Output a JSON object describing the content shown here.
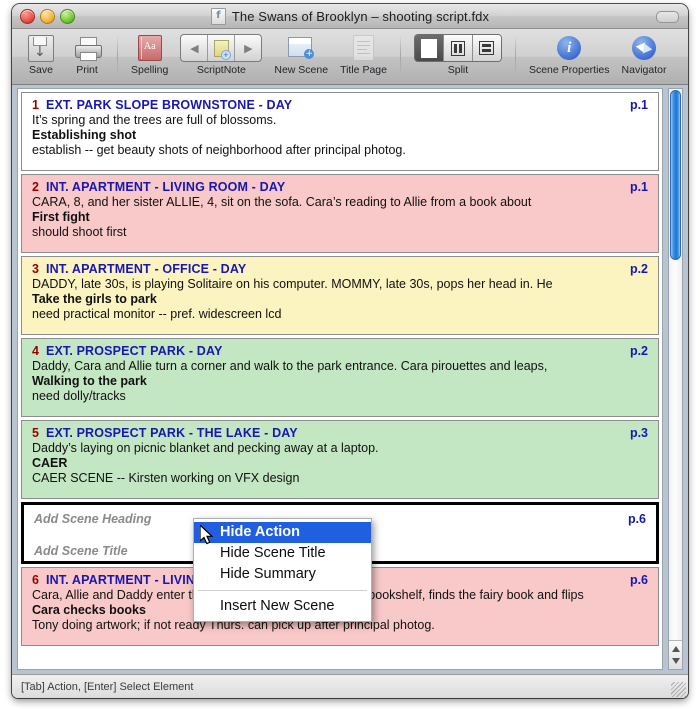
{
  "window": {
    "title": "The Swans of Brooklyn – shooting script.fdx",
    "doc_icon": "script-document-icon",
    "traffic_lights": [
      "close-button",
      "minimize-button",
      "zoom-button"
    ]
  },
  "toolbar": {
    "items": [
      {
        "label": "Save",
        "icon": "save-icon"
      },
      {
        "label": "Print",
        "icon": "print-icon"
      },
      {
        "label": "Spelling",
        "icon": "spelling-icon"
      },
      {
        "label": "ScriptNote",
        "icon": "scriptnote-icon"
      },
      {
        "label": "New Scene",
        "icon": "new-scene-icon"
      },
      {
        "label": "Title Page",
        "icon": "title-page-icon"
      },
      {
        "label": "Split",
        "icon": "split-icon"
      },
      {
        "label": "Scene Properties",
        "icon": "info-icon"
      },
      {
        "label": "Navigator",
        "icon": "compass-icon"
      }
    ],
    "spelling_glyph": "Aa",
    "split_selected": "single-pane"
  },
  "cards": [
    {
      "number": "1",
      "heading": "EXT. PARK SLOPE BROWNSTONE - DAY",
      "page": "p.1",
      "action": "It’s spring and the trees are full of blossoms.",
      "title": "Establishing shot",
      "summary": "establish -- get beauty shots of neighborhood after principal photog.",
      "color": "#ffffff"
    },
    {
      "number": "2",
      "heading": "INT. APARTMENT - LIVING ROOM - DAY",
      "page": "p.1",
      "action": "CARA, 8, and her sister ALLIE, 4, sit on the sofa.  Cara’s reading to Allie from a book about",
      "title": "First fight",
      "summary": "should shoot first",
      "color": "#f9c8c8"
    },
    {
      "number": "3",
      "heading": "INT. APARTMENT - OFFICE - DAY",
      "page": "p.2",
      "action": "DADDY, late 30s, is playing Solitaire on his computer.  MOMMY, late 30s, pops her head in.  He",
      "title": "Take the girls to park",
      "summary": "need practical monitor -- pref. widescreen lcd",
      "color": "#fbf3c0"
    },
    {
      "number": "4",
      "heading": "EXT. PROSPECT PARK - DAY",
      "page": "p.2",
      "action": "Daddy, Cara and Allie turn a corner and walk to the park entrance.  Cara pirouettes and leaps,",
      "title": "Walking to the park",
      "summary": "need dolly/tracks",
      "color": "#c3e7c3"
    },
    {
      "number": "5",
      "heading": "EXT. PROSPECT PARK - THE LAKE - DAY",
      "page": "p.3",
      "action": "Daddy’s laying on picnic blanket and pecking away at a laptop.",
      "title": "CAER",
      "summary": "CAER SCENE -- Kirsten working on VFX design",
      "color": "#c3e7c3"
    }
  ],
  "new_card": {
    "heading_placeholder": "Add Scene Heading",
    "title_placeholder": "Add Scene Title",
    "page": "p.6",
    "color": "#ffffff"
  },
  "last_card": {
    "number": "6",
    "heading": "INT. APARTMENT - LIVING ROOM - DAY",
    "page": "p.6",
    "action": "Cara, Allie and Daddy enter the apartment.  Cara goes to the bookshelf, finds the fairy book and flips",
    "title": "Cara checks books",
    "summary": "Tony doing artwork; if not ready Thurs. can pick up after principal photog.",
    "color": "#f9c8c8"
  },
  "context_menu": {
    "items": [
      {
        "label": "Hide Action",
        "highlighted": true
      },
      {
        "label": "Hide Scene Title",
        "highlighted": false
      },
      {
        "label": "Hide Summary",
        "highlighted": false
      },
      {
        "label": "Insert New Scene",
        "highlighted": false
      }
    ]
  },
  "statusbar": {
    "hint": "[Tab] Action,  [Enter] Select Element"
  },
  "colors": {
    "scene_number": "#9b0000",
    "scene_heading": "#1818b0",
    "menu_highlight": "#1f5fe0",
    "window_chrome": "#d0d0d0"
  }
}
